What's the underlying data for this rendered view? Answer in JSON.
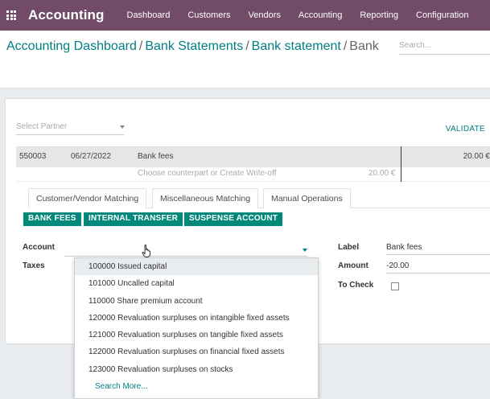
{
  "nav": {
    "brand": "Accounting",
    "items": [
      "Dashboard",
      "Customers",
      "Vendors",
      "Accounting",
      "Reporting",
      "Configuration"
    ]
  },
  "breadcrumb": {
    "crumbs": [
      "Accounting Dashboard",
      "Bank Statements",
      "Bank statement"
    ],
    "current": "Bank",
    "sep": "/"
  },
  "search": {
    "placeholder": "Search..."
  },
  "reconcile": {
    "partner_placeholder": "Select Partner",
    "validate_label": "VALIDATE",
    "line": {
      "ref": "550003",
      "date": "06/27/2022",
      "label": "Bank fees",
      "amount": "20.00 €"
    },
    "sub_line": {
      "text": "Choose counterpart or Create Write-off",
      "amount": "20.00 €"
    }
  },
  "tabs": [
    "Customer/Vendor Matching",
    "Miscellaneous Matching",
    "Manual Operations"
  ],
  "active_tab": "Manual Operations",
  "quick_buttons": [
    "BANK FEES",
    "INTERNAL TRANSFER",
    "SUSPENSE ACCOUNT"
  ],
  "form": {
    "account_label": "Account",
    "taxes_label": "Taxes",
    "label_label": "Label",
    "label_value": "Bank fees",
    "amount_label": "Amount",
    "amount_value": "-20.00",
    "to_check_label": "To Check"
  },
  "account_dropdown": {
    "options": [
      "100000 Issued capital",
      "101000 Uncalled capital",
      "110000 Share premium account",
      "120000 Revaluation surpluses on intangible fixed assets",
      "121000 Revaluation surpluses on tangible fixed assets",
      "122000 Revaluation surpluses on financial fixed assets",
      "123000 Revaluation surpluses on stocks"
    ],
    "search_more": "Search More..."
  },
  "colors": {
    "navbar": "#714B67",
    "accent": "#017e84",
    "button": "#00897B"
  }
}
